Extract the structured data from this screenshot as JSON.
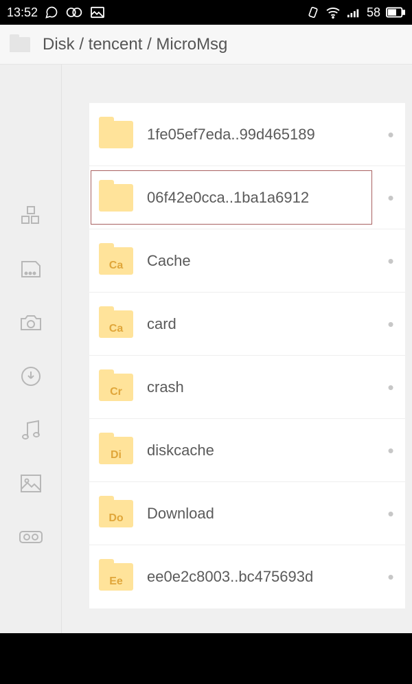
{
  "status": {
    "time": "13:52",
    "battery": "58"
  },
  "breadcrumb": {
    "text": "Disk / tencent / MicroMsg"
  },
  "sidebar": {
    "items": [
      {
        "id": "category",
        "name": "category-icon"
      },
      {
        "id": "storage",
        "name": "storage-icon"
      },
      {
        "id": "camera",
        "name": "camera-icon"
      },
      {
        "id": "download",
        "name": "download-icon"
      },
      {
        "id": "music",
        "name": "music-icon"
      },
      {
        "id": "picture",
        "name": "picture-icon"
      },
      {
        "id": "infinity",
        "name": "infinity-icon"
      }
    ]
  },
  "files": [
    {
      "label": "",
      "name": "1fe05ef7eda..99d465189",
      "highlight": false
    },
    {
      "label": "",
      "name": "06f42e0cca..1ba1a6912",
      "highlight": true
    },
    {
      "label": "Ca",
      "name": "Cache",
      "highlight": false
    },
    {
      "label": "Ca",
      "name": "card",
      "highlight": false
    },
    {
      "label": "Cr",
      "name": "crash",
      "highlight": false
    },
    {
      "label": "Di",
      "name": "diskcache",
      "highlight": false
    },
    {
      "label": "Do",
      "name": "Download",
      "highlight": false
    },
    {
      "label": "Ee",
      "name": "ee0e2c8003..bc475693d",
      "highlight": false
    }
  ]
}
